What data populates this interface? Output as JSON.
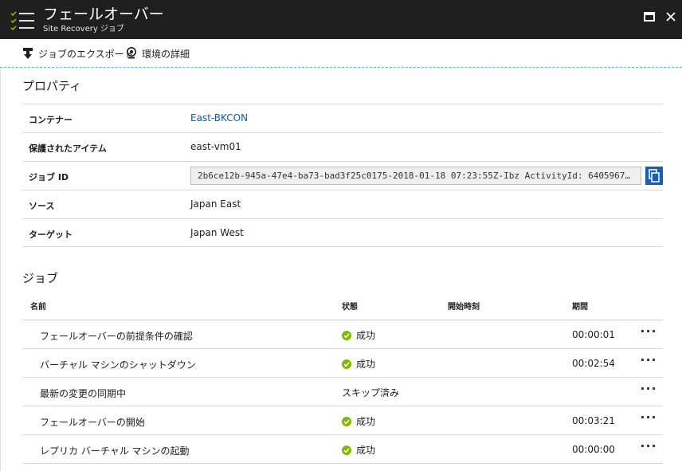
{
  "header": {
    "title": "フェールオーバー",
    "subtitle": "Site Recovery ジョブ"
  },
  "toolbar": {
    "export_label": "ジョブのエクスポート",
    "env_label": "環境の詳細"
  },
  "properties": {
    "section_title": "プロパティ",
    "container_label": "コンテナー",
    "container_value": "East-BKCON",
    "protected_item_label": "保護されたアイテム",
    "protected_item_value": "east-vm01",
    "job_id_label": "ジョブ ID",
    "job_id_value": "2b6ce12b-945a-47e4-ba73-bad3f25c0175-2018-01-18 07:23:55Z-Ibz ActivityId: 6405967…",
    "source_label": "ソース",
    "source_value": "Japan East",
    "target_label": "ターゲット",
    "target_value": "Japan West"
  },
  "jobs": {
    "section_title": "ジョブ",
    "columns": {
      "name": "名前",
      "status": "状態",
      "start_time": "開始時刻",
      "duration": "期間"
    },
    "more_label": "···",
    "rows": [
      {
        "name": "フェールオーバーの前提条件の確認",
        "status": "成功",
        "success": true,
        "duration": "00:00:01"
      },
      {
        "name": "バーチャル マシンのシャットダウン",
        "status": "成功",
        "success": true,
        "duration": "00:02:54"
      },
      {
        "name": "最新の変更の同期中",
        "status": "スキップ済み",
        "success": false,
        "duration": ""
      },
      {
        "name": "フェールオーバーの開始",
        "status": "成功",
        "success": true,
        "duration": "00:03:21"
      },
      {
        "name": "レプリカ バーチャル マシンの起動",
        "status": "成功",
        "success": true,
        "duration": "00:00:00"
      }
    ]
  },
  "colors": {
    "header_bg": "#1f1f1f",
    "link": "#0a5eaa",
    "success": "#7fba00",
    "accent": "#1660b5"
  }
}
